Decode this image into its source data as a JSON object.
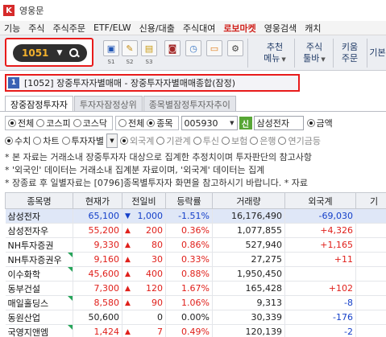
{
  "app": {
    "title": "영웅문",
    "logo": "K"
  },
  "menu": [
    "기능",
    "주식",
    "주식주문",
    "ETF/ELW",
    "신용/대출",
    "주식대여",
    "로보마켓",
    "영웅검색",
    "캐치"
  ],
  "toolbar": {
    "code": "1051",
    "slot_labels": [
      "S1",
      "S2",
      "S3"
    ],
    "menus": [
      {
        "line1": "추천",
        "line2": "메뉴"
      },
      {
        "line1": "주식",
        "line2": "툴바"
      },
      {
        "line1": "키움",
        "line2": "주문"
      },
      {
        "line1": "",
        "line2": ""
      }
    ],
    "last_menu": {
      "line1": "",
      "line2": "기본"
    }
  },
  "window": {
    "number": "1",
    "title": "[1052] 장중투자자별매매 - 장중투자자별매매종합(잠정)"
  },
  "tabs": [
    "장중잠정투자자",
    "투자자잠정상위",
    "종목별잠정투자자추이"
  ],
  "filters": {
    "market": [
      "전체",
      "코스피",
      "코스닥"
    ],
    "scope": [
      "전체",
      "종목"
    ],
    "stock_code": "005930",
    "sin_badge": "신",
    "stock_name": "삼성전자",
    "unit": "금액",
    "row2_mode": [
      "수치",
      "차트",
      "투자자별"
    ],
    "investors": [
      "외국계",
      "기관계",
      "투신",
      "보험",
      "은행",
      "연기금등"
    ]
  },
  "notes": [
    "* 본 자료는 거래소내 장중투자자 대상으로 집계한 추정치이며 투자판단의 참고사항",
    "* '외국인' 데이터는 거래소내 집계분 자료이며, '외국계' 데이터는 집계",
    "* 장종료 후 일별자료는 [0796]종목별투자자 화면을 참고하시기 바랍니다. * 자료"
  ],
  "table": {
    "columns": [
      "종목명",
      "현재가",
      "전일비",
      "등락률",
      "거래량",
      "외국계",
      "기"
    ],
    "rows": [
      {
        "name": "삼성전자",
        "price": "65,100",
        "dir": "down",
        "change": "1,000",
        "rate": "-1.51%",
        "volume": "16,176,490",
        "foreign": "-69,030",
        "mark": false,
        "selected": true
      },
      {
        "name": "삼성전자우",
        "price": "55,200",
        "dir": "up",
        "change": "200",
        "rate": "0.36%",
        "volume": "1,077,855",
        "foreign": "+4,326",
        "mark": false,
        "selected": false
      },
      {
        "name": "NH투자증권",
        "price": "9,330",
        "dir": "up",
        "change": "80",
        "rate": "0.86%",
        "volume": "527,940",
        "foreign": "+1,165",
        "mark": false,
        "selected": false
      },
      {
        "name": "NH투자증권우",
        "price": "9,160",
        "dir": "up",
        "change": "30",
        "rate": "0.33%",
        "volume": "27,275",
        "foreign": "+11",
        "mark": true,
        "selected": false
      },
      {
        "name": "이수화학",
        "price": "45,600",
        "dir": "up",
        "change": "400",
        "rate": "0.88%",
        "volume": "1,950,450",
        "foreign": "",
        "mark": true,
        "selected": false
      },
      {
        "name": "동부건설",
        "price": "7,300",
        "dir": "up",
        "change": "120",
        "rate": "1.67%",
        "volume": "165,428",
        "foreign": "+102",
        "mark": false,
        "selected": false
      },
      {
        "name": "매일홀딩스",
        "price": "8,580",
        "dir": "up",
        "change": "90",
        "rate": "1.06%",
        "volume": "9,313",
        "foreign": "-8",
        "mark": true,
        "selected": false
      },
      {
        "name": "동원산업",
        "price": "50,600",
        "dir": "flat",
        "change": "0",
        "rate": "0.00%",
        "volume": "30,339",
        "foreign": "-176",
        "mark": false,
        "selected": false
      },
      {
        "name": "국영지앤엠",
        "price": "1,424",
        "dir": "up",
        "change": "7",
        "rate": "0.49%",
        "volume": "120,139",
        "foreign": "-2",
        "mark": true,
        "selected": false
      }
    ]
  }
}
